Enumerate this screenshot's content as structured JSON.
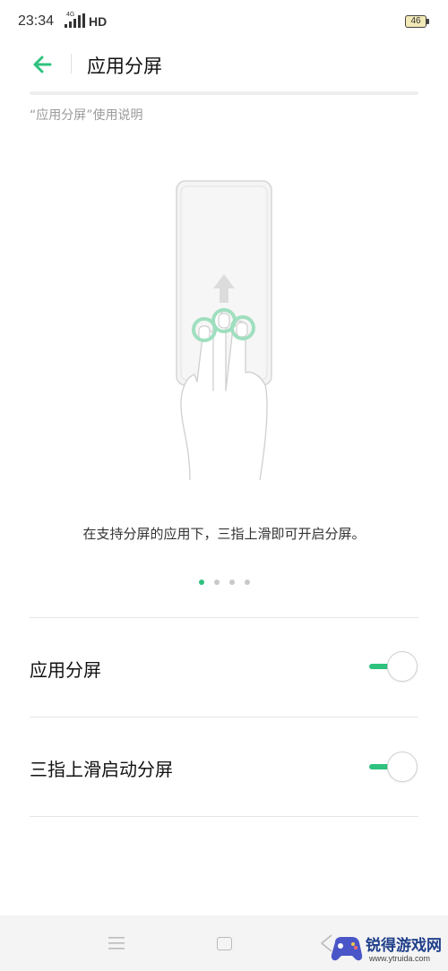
{
  "status_bar": {
    "time": "23:34",
    "network": "4G",
    "hd": "HD",
    "battery": "46"
  },
  "header": {
    "title": "应用分屏",
    "back_icon": "arrow-left-icon",
    "accent_color": "#2ec27e"
  },
  "guide": {
    "caption": "“应用分屏”使用说明",
    "illustration_icon": "three-finger-swipe-up-illustration",
    "instruction": "在支持分屏的应用下，三指上滑即可开启分屏。",
    "pager": {
      "pages": 4,
      "active_index": 0
    }
  },
  "settings": [
    {
      "label": "应用分屏",
      "enabled": true
    },
    {
      "label": "三指上滑启动分屏",
      "enabled": true
    }
  ],
  "nav_bar": {
    "icons": [
      "menu-icon",
      "home-icon",
      "back-icon"
    ]
  },
  "watermark": {
    "title": "锐得游戏网",
    "url": "www.ytruida.com"
  }
}
